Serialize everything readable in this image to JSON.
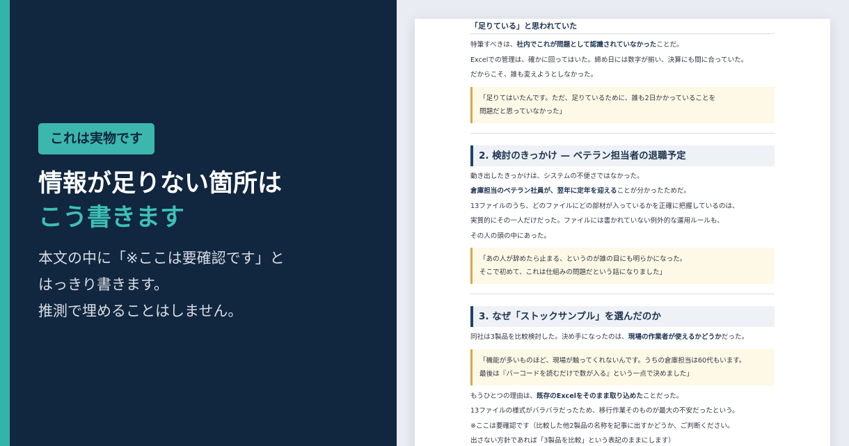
{
  "left": {
    "badge": "これは実物です",
    "headline_line1": "情報が足りない箇所は",
    "headline_line2": "こう書きます",
    "lead": [
      "本文の中に「※ここは要確認です」と",
      "はっきり書きます。",
      "推測で埋めることはしません。"
    ]
  },
  "doc": {
    "top_heading": "「足りている」と思われていた",
    "p1_pre": "特筆すべきは、",
    "p1_bold": "社内でこれが問題として認識されていなかった",
    "p1_post": "ことだ。",
    "p2": "Excelでの管理は、確かに回ってはいた。締め日には数字が揃い、決算にも間に合っていた。",
    "p3": "だからこそ、誰も変えようとしなかった。",
    "quote1": [
      "「足りてはいたんです。ただ、足りているために、誰も2日かかっていることを",
      "問題だと思っていなかった」"
    ],
    "section2": "2. 検討のきっかけ — ベテラン担当者の退職予定",
    "p4": "動き出したきっかけは、システムの不便さではなかった。",
    "p5_bold": "倉庫担当のベテラン社員が、翌年に定年を迎える",
    "p5_post": "ことが分かったためだ。",
    "p6": "13ファイルのうち、どのファイルにどの部材が入っているかを正確に把握しているのは、",
    "p7": "実質的にその一人だけだった。ファイルには書かれていない例外的な運用ルールも、",
    "p8": "その人の頭の中にあった。",
    "quote2": [
      "「あの人が辞めたら止まる、というのが誰の目にも明らかになった。",
      "そこで初めて、これは仕組みの問題だという話になりました」"
    ],
    "section3": "3. なぜ「ストックサンプル」を選んだのか",
    "p9_pre": "同社は3製品を比較検討した。決め手になったのは、",
    "p9_bold": "現場の作業者が使えるかどうか",
    "p9_post": "だった。",
    "quote3": [
      "「機能が多いものほど、現場が触ってくれないんです。うちの倉庫担当は60代もいます。",
      "最後は『バーコードを読むだけで数が入る』という一点で決めました」"
    ],
    "p10_pre": "もうひとつの理由は、",
    "p10_bold": "既存のExcelをそのまま取り込めた",
    "p10_post": "ことだった。",
    "p11": "13ファイルの様式がバラバラだったため、移行作業そのものが最大の不安だったという。",
    "p12": "※ここは要確認です（比較した他2製品の名称を記事に出すかどうか、ご判断ください。",
    "p13": "出さない方針であれば「3製品を比較」という表記のままにします）"
  }
}
